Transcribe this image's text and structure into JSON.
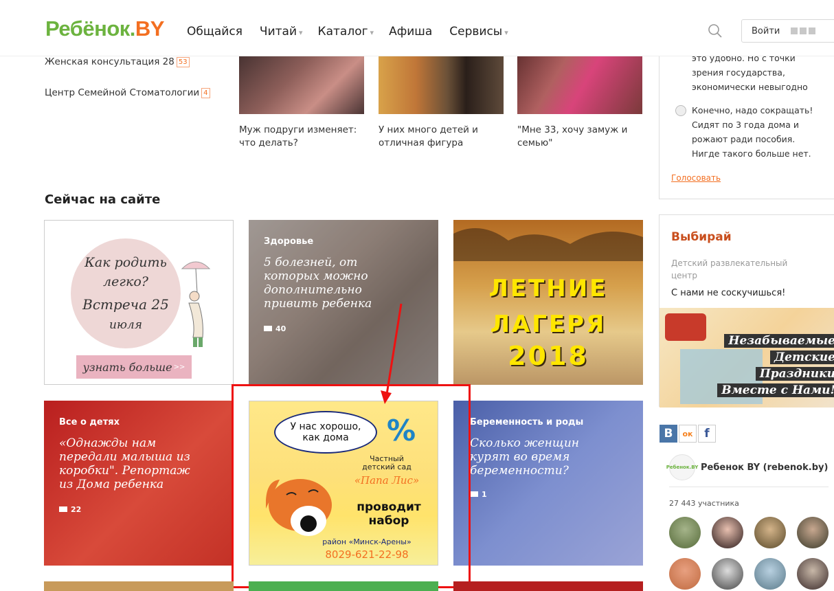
{
  "header": {
    "logo_part1": "Ребёнок.",
    "logo_part2": "BY",
    "nav": [
      {
        "label": "Общайся",
        "caret": ""
      },
      {
        "label": "Читай",
        "caret": "▾"
      },
      {
        "label": "Каталог",
        "caret": "▾"
      },
      {
        "label": "Афиша",
        "caret": ""
      },
      {
        "label": "Сервисы",
        "caret": "▾"
      }
    ],
    "login_label": "Войти"
  },
  "clinics": [
    {
      "name": "Женская консультация 28",
      "count": "53"
    },
    {
      "name": "Центр Семейной Стоматологии",
      "count": "4"
    }
  ],
  "articles": [
    {
      "title": "Муж подруги изменяет: что делать?"
    },
    {
      "title": "У них много детей и отличная фигура"
    },
    {
      "title": "\"Мне 33, хочу замуж и семью\""
    }
  ],
  "poll": {
    "option1_tail": [
      "это удобно. Но с точки",
      "зрения государства,",
      "экономически невыгодно"
    ],
    "option2": [
      "Конечно, надо сокращать!",
      "Сидят по 3 года дома и",
      "рожают ради пособия.",
      "Нигде такого больше нет."
    ],
    "vote_label": "Голосовать"
  },
  "section_title": "Сейчас на сайте",
  "tiles": {
    "birth": {
      "lines": [
        "Как родить",
        "легко?",
        "Встреча 25",
        "июля"
      ],
      "button": "узнать больше"
    },
    "health": {
      "category": "Здоровье",
      "headline": "5 болезней, от которых можно дополнительно привить ребенка",
      "comments": "40"
    },
    "camp": {
      "line1": "ЛЕТНИЕ",
      "line2": "ЛАГЕРЯ",
      "line3": "2018"
    },
    "kids": {
      "category": "Все о детях",
      "headline": "«Однажды нам передали малыша из коробки\". Репортаж из Дома ребенка",
      "comments": "22"
    },
    "ad": {
      "cloud_line1": "У нас хорошо,",
      "cloud_line2": "как дома",
      "percent": "%",
      "private": "Частный",
      "kindergarten": "детский сад",
      "name": "«Папа Лис»",
      "recruit1": "проводит",
      "recruit2": "набор",
      "district": "район «Минск-Арены»",
      "phone": "8029-621-22-98"
    },
    "pregnancy": {
      "category": "Беременность и роды",
      "headline": "Сколько женщин курят во время беременности?",
      "comments": "1"
    }
  },
  "sidebar": {
    "choose_title": "Выбирай",
    "choose_sub": "Детский развлекательный центр",
    "choose_desc": "С нами не соскучишься!",
    "banner_lines": [
      "Незабываемые",
      "Детские",
      "Праздники",
      "Вместе с Нами!"
    ],
    "social": {
      "vk": "В",
      "ok": "ок",
      "fb": "f"
    },
    "group_avatar_text": "Ребенок.BY",
    "group_name": "Ребенок BY (rebenok.by)",
    "members": "27 443 участника"
  },
  "colors": {
    "brand_green": "#6cb33f",
    "brand_orange": "#f36f21",
    "highlight_red": "#ee1111"
  }
}
